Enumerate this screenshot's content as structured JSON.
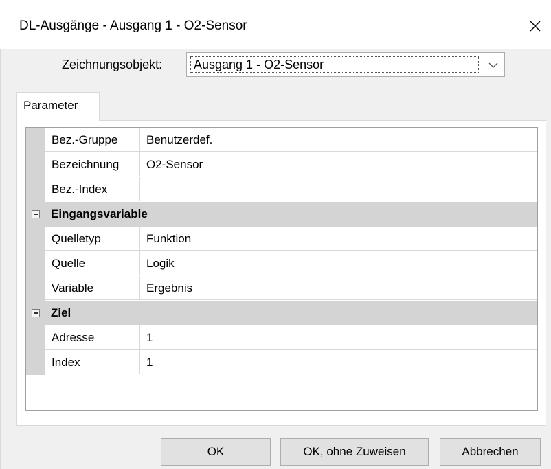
{
  "window": {
    "title": "DL-Ausgänge - Ausgang 1 - O2-Sensor"
  },
  "header": {
    "object_label": "Zeichnungsobjekt:",
    "object_value": "Ausgang 1 - O2-Sensor"
  },
  "tabs": [
    {
      "label": "Parameter"
    }
  ],
  "grid": {
    "top_rows": [
      {
        "name": "Bez.-Gruppe",
        "value": "Benutzerdef."
      },
      {
        "name": "Bezeichnung",
        "value": "O2-Sensor"
      },
      {
        "name": "Bez.-Index",
        "value": ""
      }
    ],
    "categories": [
      {
        "label": "Eingangsvariable",
        "rows": [
          {
            "name": "Quelletyp",
            "value": "Funktion"
          },
          {
            "name": "Quelle",
            "value": "Logik"
          },
          {
            "name": "Variable",
            "value": "Ergebnis"
          }
        ]
      },
      {
        "label": "Ziel",
        "rows": [
          {
            "name": "Adresse",
            "value": "1"
          },
          {
            "name": "Index",
            "value": "1"
          }
        ]
      }
    ]
  },
  "buttons": {
    "ok": "OK",
    "ok_no_assign": "OK, ohne Zuweisen",
    "cancel": "Abbrechen"
  },
  "icons": {
    "close": "close-icon",
    "dropdown": "chevron-down-icon",
    "collapse": "minus-box-icon"
  }
}
